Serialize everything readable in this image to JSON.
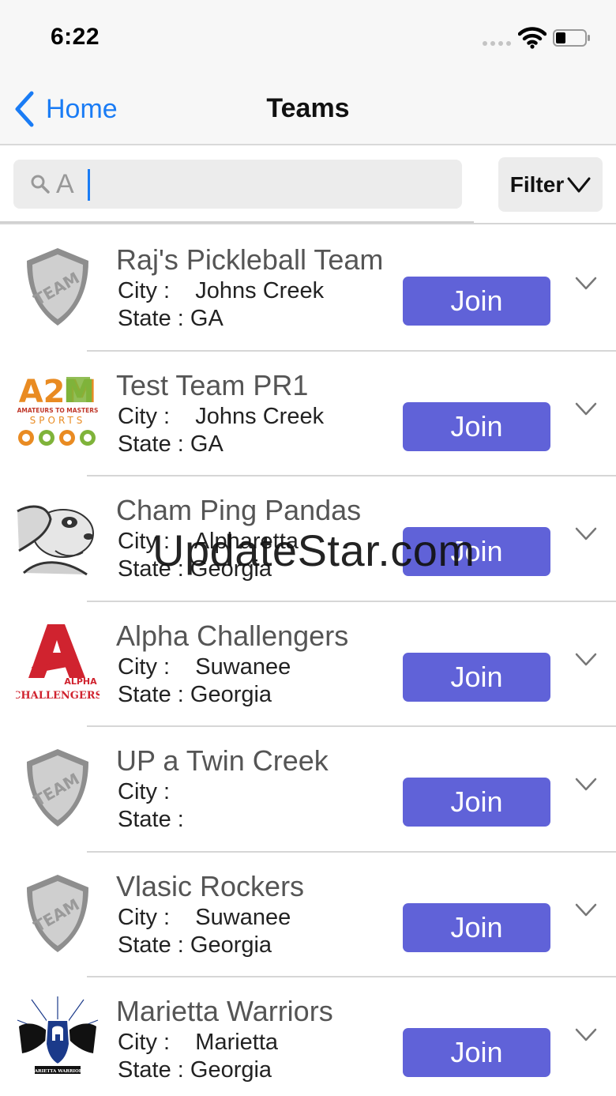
{
  "status_bar": {
    "time": "6:22"
  },
  "nav": {
    "back_label": "Home",
    "title": "Teams"
  },
  "search": {
    "value": "A",
    "filter_label": "Filter"
  },
  "teams": [
    {
      "name": "Raj's Pickleball Team",
      "city_label": "City :",
      "city": "Johns Creek",
      "state_label": "State :",
      "state": "GA",
      "logo": "shield-team-logo",
      "join_label": "Join"
    },
    {
      "name": "Test Team PR1",
      "city_label": "City :",
      "city": "Johns Creek",
      "state_label": "State :",
      "state": "GA",
      "logo": "a2m-sports-logo",
      "logo_text": "A2M",
      "logo_sub": "AMATEURS TO MASTERS",
      "logo_sports": "SPORTS",
      "join_label": "Join"
    },
    {
      "name": "Cham Ping Pandas",
      "city_label": "City :",
      "city": "Alpharetta",
      "state_label": "State :",
      "state": "Georgia",
      "logo": "panda-logo",
      "join_label": "Join"
    },
    {
      "name": "Alpha Challengers",
      "city_label": "City :",
      "city": "Suwanee",
      "state_label": "State :",
      "state": "Georgia",
      "logo": "alpha-challengers-logo",
      "logo_text": "ALPHA",
      "logo_sub": "CHALLENGERS",
      "join_label": "Join"
    },
    {
      "name": "UP a Twin Creek",
      "city_label": "City :",
      "city": "",
      "state_label": "State :",
      "state": "",
      "logo": "shield-team-logo",
      "join_label": "Join"
    },
    {
      "name": "Vlasic Rockers",
      "city_label": "City :",
      "city": "Suwanee",
      "state_label": "State :",
      "state": "Georgia",
      "logo": "shield-team-logo",
      "join_label": "Join"
    },
    {
      "name": "Marietta Warriors",
      "city_label": "City :",
      "city": "Marietta",
      "state_label": "State :",
      "state": "Georgia",
      "logo": "marietta-warriors-logo",
      "logo_sub": "MARIETTA WARRIORS",
      "join_label": "Join"
    }
  ],
  "shield_text": "TEAM",
  "watermark": "UpdateStar.com",
  "colors": {
    "accent": "#1a7cf5",
    "join_button": "#6062d8"
  }
}
